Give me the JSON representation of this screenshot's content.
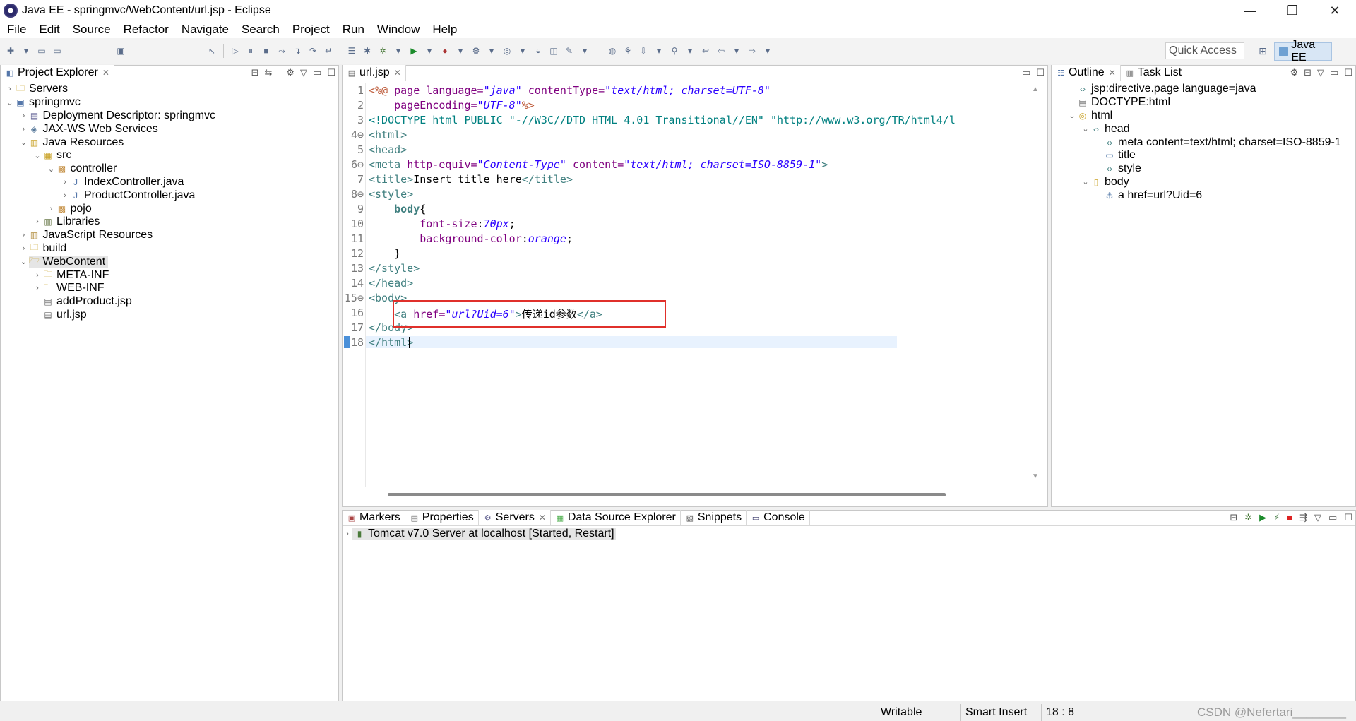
{
  "window": {
    "title": "Java EE - springmvc/WebContent/url.jsp - Eclipse",
    "minimize": "—",
    "restore": "❐",
    "close": "✕"
  },
  "menu": [
    "File",
    "Edit",
    "Source",
    "Refactor",
    "Navigate",
    "Search",
    "Project",
    "Run",
    "Window",
    "Help"
  ],
  "quick_access": "Quick Access",
  "perspective": "Java EE",
  "project_explorer": {
    "tab_label": "Project Explorer",
    "items": [
      {
        "label": "Servers",
        "indent": 0,
        "toggle": "›",
        "icon": "folder-icon"
      },
      {
        "label": "springmvc",
        "indent": 0,
        "toggle": "⌄",
        "icon": "project-icon"
      },
      {
        "label": "Deployment Descriptor: springmvc",
        "indent": 1,
        "toggle": "›",
        "icon": "descriptor-icon"
      },
      {
        "label": "JAX-WS Web Services",
        "indent": 1,
        "toggle": "›",
        "icon": "webservice-icon"
      },
      {
        "label": "Java Resources",
        "indent": 1,
        "toggle": "⌄",
        "icon": "java-resources-icon"
      },
      {
        "label": "src",
        "indent": 2,
        "toggle": "⌄",
        "icon": "source-folder-icon"
      },
      {
        "label": "controller",
        "indent": 3,
        "toggle": "⌄",
        "icon": "package-icon"
      },
      {
        "label": "IndexController.java",
        "indent": 4,
        "toggle": "›",
        "icon": "java-file-icon"
      },
      {
        "label": "ProductController.java",
        "indent": 4,
        "toggle": "›",
        "icon": "java-file-icon"
      },
      {
        "label": "pojo",
        "indent": 3,
        "toggle": "›",
        "icon": "package-icon"
      },
      {
        "label": "Libraries",
        "indent": 2,
        "toggle": "›",
        "icon": "library-icon"
      },
      {
        "label": "JavaScript Resources",
        "indent": 1,
        "toggle": "›",
        "icon": "js-resources-icon"
      },
      {
        "label": "build",
        "indent": 1,
        "toggle": "›",
        "icon": "folder-icon"
      },
      {
        "label": "WebContent",
        "indent": 1,
        "toggle": "⌄",
        "icon": "open-folder-icon",
        "selected": true
      },
      {
        "label": "META-INF",
        "indent": 2,
        "toggle": "›",
        "icon": "folder-icon"
      },
      {
        "label": "WEB-INF",
        "indent": 2,
        "toggle": "›",
        "icon": "folder-icon"
      },
      {
        "label": "addProduct.jsp",
        "indent": 2,
        "toggle": "",
        "icon": "jsp-file-icon"
      },
      {
        "label": "url.jsp",
        "indent": 2,
        "toggle": "",
        "icon": "jsp-file-icon"
      }
    ]
  },
  "editor": {
    "tab_label": "url.jsp",
    "line_numbers": [
      "1",
      "2",
      "3",
      "4⊖",
      "5",
      "6⊖",
      "7",
      "8⊖",
      "9",
      "10",
      "11",
      "12",
      "13",
      "14",
      "15⊖",
      "16",
      "17",
      "18"
    ],
    "lines": {
      "l1a": "<%@ ",
      "l1b": "page ",
      "l1c": "language=",
      "l1d": "\"java\"",
      "l1e": " contentType=",
      "l1f": "\"text/html; charset=UTF-8\"",
      "l2a": "    pageEncoding=",
      "l2b": "\"UTF-8\"",
      "l2c": "%>",
      "l3a": "<!DOCTYPE html PUBLIC ",
      "l3b": "\"-//W3C//DTD HTML 4.01 Transitional//EN\"",
      "l3c": " \"http://www.w3.org/TR/html4/l",
      "l4": "<html>",
      "l5": "<head>",
      "l6a": "<meta ",
      "l6b": "http-equiv=",
      "l6c": "\"Content-Type\"",
      "l6d": " content=",
      "l6e": "\"text/html; charset=ISO-8859-1\"",
      "l6f": ">",
      "l7a": "<title>",
      "l7b": "Insert title here",
      "l7c": "</title>",
      "l8": "<style>",
      "l9a": "    body",
      "l9b": "{",
      "l10a": "        font-size",
      "l10b": ":",
      "l10c": "70px",
      "l10d": ";",
      "l11a": "        background-color",
      "l11b": ":",
      "l11c": "orange",
      "l11d": ";",
      "l12": "    }",
      "l13": "</style>",
      "l14": "</head>",
      "l15": "<body>",
      "l16a": "    <a ",
      "l16b": "href=",
      "l16c": "\"url?Uid=6\"",
      "l16d": ">",
      "l16e": "传递id参数",
      "l16f": "</a>",
      "l17": "</body>",
      "l18": "</html>"
    }
  },
  "outline": {
    "tab_label": "Outline",
    "tab2_label": "Task List",
    "items": [
      {
        "label": "jsp:directive.page language=java",
        "indent": 0,
        "toggle": "",
        "icon": "tag-icon"
      },
      {
        "label": "DOCTYPE:html",
        "indent": 0,
        "toggle": "",
        "icon": "doctype-icon"
      },
      {
        "label": "html",
        "indent": 0,
        "toggle": "⌄",
        "icon": "html-icon"
      },
      {
        "label": "head",
        "indent": 1,
        "toggle": "⌄",
        "icon": "tag-icon"
      },
      {
        "label": "meta content=text/html; charset=ISO-8859-1",
        "indent": 2,
        "toggle": "",
        "icon": "tag-icon"
      },
      {
        "label": "title",
        "indent": 2,
        "toggle": "",
        "icon": "title-icon"
      },
      {
        "label": "style",
        "indent": 2,
        "toggle": "",
        "icon": "tag-icon"
      },
      {
        "label": "body",
        "indent": 1,
        "toggle": "⌄",
        "icon": "body-icon"
      },
      {
        "label": "a href=url?Uid=6",
        "indent": 2,
        "toggle": "",
        "icon": "anchor-icon"
      }
    ]
  },
  "bottom": {
    "tabs": [
      "Markers",
      "Properties",
      "Servers",
      "Data Source Explorer",
      "Snippets",
      "Console"
    ],
    "active_tab": "Servers",
    "server_row": "Tomcat v7.0 Server at localhost  [Started, Restart]"
  },
  "status": {
    "writable": "Writable",
    "insert_mode": "Smart Insert",
    "position": "18 : 8",
    "watermark": "CSDN @Nefertari________"
  },
  "colors": {
    "accent": "#d8e6f5",
    "highlight_box": "#e0302b",
    "current_line": "#e8f2fe"
  }
}
